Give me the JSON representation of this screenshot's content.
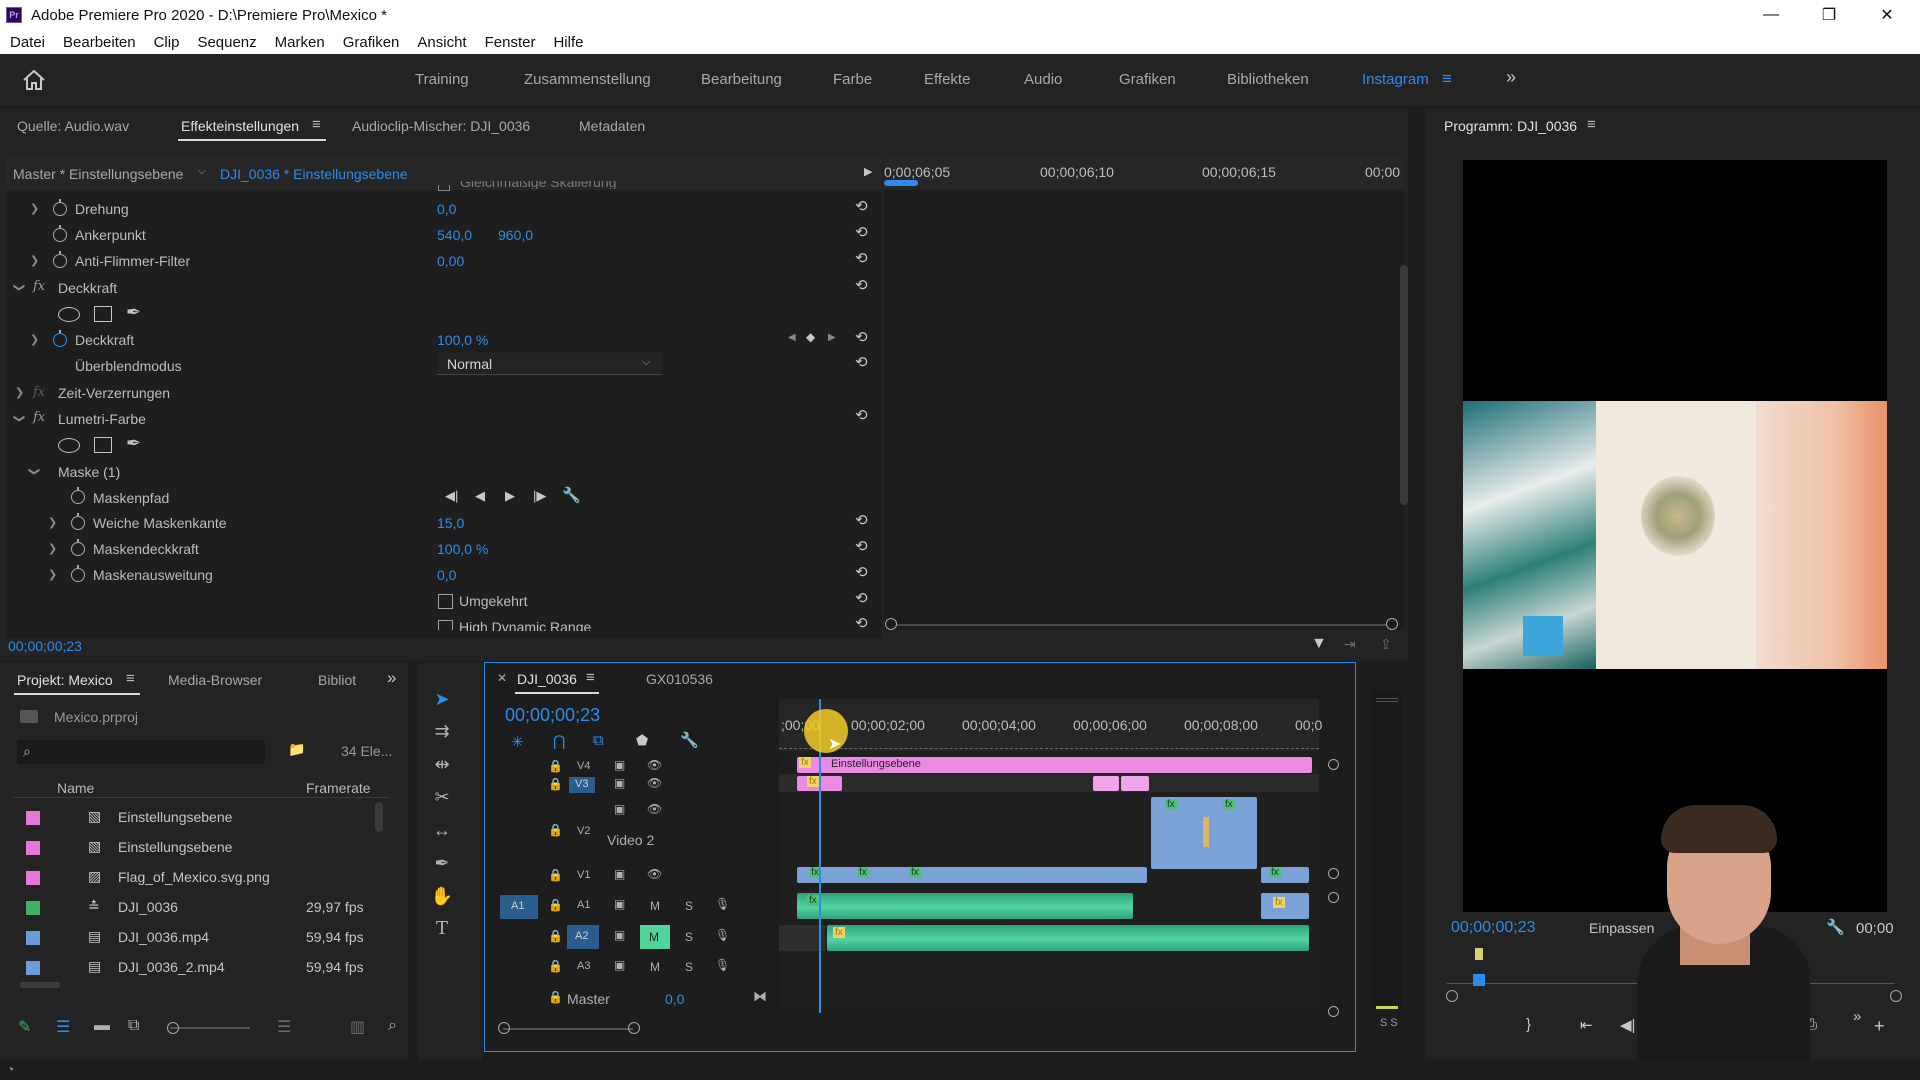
{
  "window": {
    "app_icon": "Pr",
    "title": "Adobe Premiere Pro 2020 - D:\\Premiere Pro\\Mexico *",
    "minimize": "—",
    "maximize": "❐",
    "close": "✕"
  },
  "menu": [
    "Datei",
    "Bearbeiten",
    "Clip",
    "Sequenz",
    "Marken",
    "Grafiken",
    "Ansicht",
    "Fenster",
    "Hilfe"
  ],
  "workspaces": {
    "items": [
      "Training",
      "Zusammenstellung",
      "Bearbeitung",
      "Farbe",
      "Effekte",
      "Audio",
      "Grafiken",
      "Bibliotheken",
      "Instagram"
    ],
    "active": "Instagram",
    "overflow": "»"
  },
  "source_panel": {
    "tabs": [
      "Quelle: Audio.wav",
      "Effekteinstellungen",
      "Audioclip-Mischer: DJI_0036",
      "Metadaten"
    ],
    "active_tab": "Effekteinstellungen",
    "master_label": "Master * Einstellungsebene",
    "clip_label": "DJI_0036 * Einstellungsebene",
    "cut_text": "Gleichmäßige Skalierung",
    "ruler": [
      "0;00;06;05",
      "00;00;06;10",
      "00;00;06;15",
      "00;00"
    ],
    "properties": {
      "drehung": {
        "label": "Drehung",
        "value": "0,0"
      },
      "ankerpunkt": {
        "label": "Ankerpunkt",
        "value1": "540,0",
        "value2": "960,0"
      },
      "antiflimmer": {
        "label": "Anti-Flimmer-Filter",
        "value": "0,00"
      },
      "deckkraft_group": {
        "label": "Deckkraft"
      },
      "deckkraft": {
        "label": "Deckkraft",
        "value": "100,0 %"
      },
      "blendmode": {
        "label": "Überblendmodus",
        "value": "Normal"
      },
      "zeit": {
        "label": "Zeit-Verzerrungen"
      },
      "lumetri": {
        "label": "Lumetri-Farbe"
      },
      "maske": {
        "label": "Maske (1)"
      },
      "maskenpfad": {
        "label": "Maskenpfad"
      },
      "weiche": {
        "label": "Weiche Maskenkante",
        "value": "15,0"
      },
      "maskendeck": {
        "label": "Maskendeckkraft",
        "value": "100,0 %"
      },
      "ausweitung": {
        "label": "Maskenausweitung",
        "value": "0,0"
      },
      "umgekehrt": {
        "label": "Umgekehrt"
      },
      "hdr": {
        "label": "High Dynamic Range"
      }
    },
    "timecode": "00;00;00;23"
  },
  "program_monitor": {
    "title": "Programm: DJI_0036",
    "timecode": "00;00;00;23",
    "fit": "Einpassen",
    "end_time": "00;00"
  },
  "project_panel": {
    "tabs": [
      "Projekt: Mexico",
      "Media-Browser",
      "Bibliot"
    ],
    "project_file": "Mexico.prproj",
    "item_count": "34 Ele...",
    "columns": {
      "name": "Name",
      "framerate": "Framerate"
    },
    "items": [
      {
        "name": "Einstellungsebene",
        "framerate": "",
        "color": "#e57ad6",
        "icon": "adjustment-layer-icon"
      },
      {
        "name": "Einstellungsebene",
        "framerate": "",
        "color": "#e57ad6",
        "icon": "adjustment-layer-icon"
      },
      {
        "name": "Flag_of_Mexico.svg.png",
        "framerate": "",
        "color": "#e57ad6",
        "icon": "image-icon"
      },
      {
        "name": "DJI_0036",
        "framerate": "29,97 fps",
        "color": "#3fb35f",
        "icon": "sequence-icon"
      },
      {
        "name": "DJI_0036.mp4",
        "framerate": "59,94 fps",
        "color": "#6b9bd8",
        "icon": "video-file-icon"
      },
      {
        "name": "DJI_0036_2.mp4",
        "framerate": "59,94 fps",
        "color": "#6b9bd8",
        "icon": "video-file-icon"
      }
    ]
  },
  "timeline": {
    "tabs": [
      "DJI_0036",
      "GX010536"
    ],
    "active_tab": "DJI_0036",
    "timecode": "00;00;00;23",
    "ruler": [
      ";00;00",
      "00;00;02;00",
      "00;00;04;00",
      "00;00;06;00",
      "00;00;08;00",
      "00;0"
    ],
    "tracks": {
      "v4": "V4",
      "v3": "V3",
      "v2": "V2",
      "v2_name": "Video 2",
      "v1": "V1",
      "a1_src": "A1",
      "a1": "A1",
      "a2": "A2",
      "a3": "A3",
      "master": "Master",
      "master_value": "0,0"
    },
    "adj_clip_label": "Einstellungsebene",
    "mute": "M",
    "solo": "S",
    "meter_labels": "S S"
  }
}
